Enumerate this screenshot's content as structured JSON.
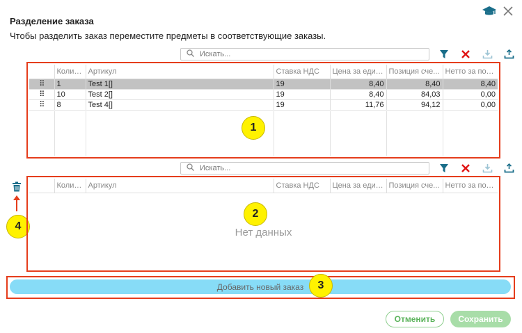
{
  "dialog": {
    "title": "Разделение заказа",
    "subtitle": "Чтобы разделить заказ переместите предметы в соответствующие заказы."
  },
  "colors": {
    "accent": "#1a6e8a",
    "red": "#e53d1c",
    "highlight": "#fff200",
    "add_button": "#87dcf7",
    "green": "#5bb35b"
  },
  "toolbar": {
    "search_placeholder": "Искать..."
  },
  "columns": [
    "Колич...",
    "Артикул",
    "Ставка НДС",
    "Цена за един...",
    "Позиция сче...",
    "Нетто за поз..."
  ],
  "grid1": {
    "rows": [
      {
        "qty": "1",
        "article": "Test 1[]",
        "vat": "19",
        "price": "8,40",
        "position": "8,40",
        "net": "8,40",
        "selected": true
      },
      {
        "qty": "10",
        "article": "Test 2[]",
        "vat": "19",
        "price": "8,40",
        "position": "84,03",
        "net": "0,00",
        "selected": false
      },
      {
        "qty": "8",
        "article": "Test 4[]",
        "vat": "19",
        "price": "11,76",
        "position": "94,12",
        "net": "0,00",
        "selected": false
      }
    ]
  },
  "grid2": {
    "empty_text": "Нет данных"
  },
  "badges": {
    "b1": "1",
    "b2": "2",
    "b3": "3",
    "b4": "4"
  },
  "actions": {
    "add_order": "Добавить новый заказ",
    "cancel": "Отменить",
    "save": "Сохранить"
  },
  "icons": [
    "graduation-cap-icon",
    "close-icon",
    "search-icon",
    "filter-icon",
    "clear-filter-icon",
    "import-icon",
    "export-icon",
    "trash-icon",
    "drag-handle-icon",
    "arrow-up-icon"
  ]
}
